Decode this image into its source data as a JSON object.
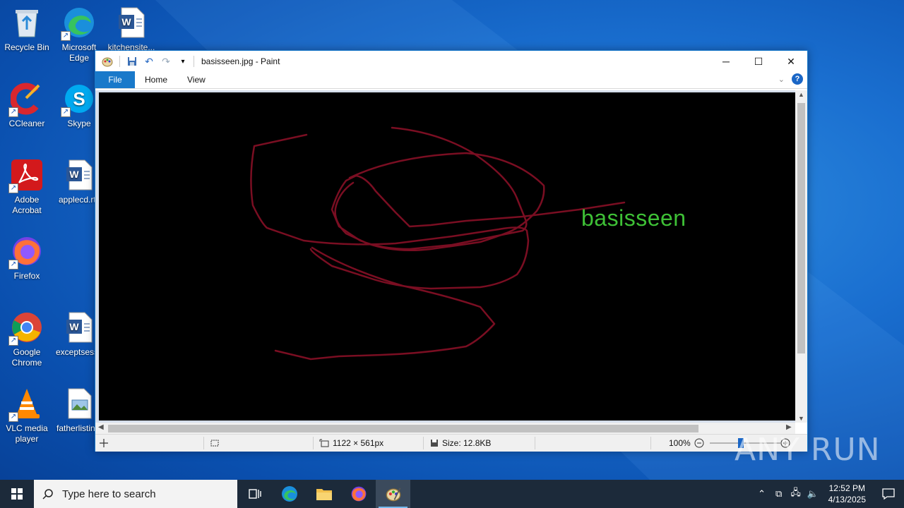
{
  "desktop": {
    "icons": [
      {
        "label": "Recycle Bin"
      },
      {
        "label": "Microsoft Edge"
      },
      {
        "label": "kitchensite..."
      },
      {
        "label": "CCleaner"
      },
      {
        "label": "Skype"
      },
      {
        "label": "Adobe Acrobat"
      },
      {
        "label": "applecd.rtf"
      },
      {
        "label": "Firefox"
      },
      {
        "label": "Google Chrome"
      },
      {
        "label": "exceptsess..."
      },
      {
        "label": "VLC media player"
      },
      {
        "label": "fatherlistin..."
      }
    ]
  },
  "paint": {
    "title": "basisseen.jpg - Paint",
    "tabs": {
      "file": "File",
      "home": "Home",
      "view": "View"
    },
    "help_label": "?",
    "canvas_text": "basisseen",
    "canvas_text_color": "#3ec036",
    "stroke_color": "#7a0e22",
    "status": {
      "dimensions": "1122 × 561px",
      "size": "Size: 12.8KB",
      "zoom": "100%"
    }
  },
  "taskbar": {
    "search_placeholder": "Type here to search",
    "time": "12:52 PM",
    "date": "4/13/2025"
  },
  "watermark": "ANY RUN",
  "colors": {
    "accent": "#1979ca",
    "taskbar": "#1c2a3a"
  }
}
